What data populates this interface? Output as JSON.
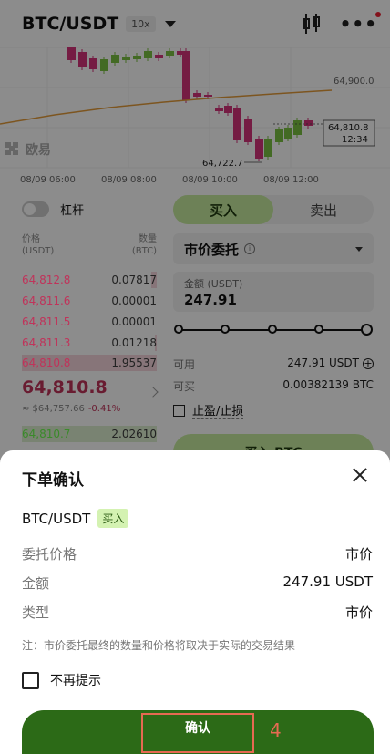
{
  "header": {
    "pair": "BTC/USDT",
    "leverage": "10x"
  },
  "chart": {
    "price_labels": [
      "64,900.0"
    ],
    "current_price_box": {
      "price": "64,810.8",
      "time": "12:34"
    },
    "low_label": "64,722.7",
    "time_labels": [
      "08/09 06:00",
      "08/09 08:00",
      "08/09 10:00",
      "08/09 12:00"
    ],
    "watermark": "欧易",
    "colors": {
      "up": "#7bc142",
      "down": "#d6347a",
      "ma": "#e39b3a"
    }
  },
  "leverage_toggle": {
    "label": "杠杆"
  },
  "orderbook": {
    "header": {
      "price": "价格",
      "price_unit": "(USDT)",
      "qty": "数量",
      "qty_unit": "(BTC)"
    },
    "asks": [
      {
        "price": "64,812.8",
        "qty": "0.07817"
      },
      {
        "price": "64,811.6",
        "qty": "0.00001"
      },
      {
        "price": "64,811.5",
        "qty": "0.00001"
      },
      {
        "price": "64,811.3",
        "qty": "0.01218"
      },
      {
        "price": "64,810.8",
        "qty": "1.95537"
      }
    ],
    "last_price": "64,810.8",
    "last_ref": "≈ $64,757.66",
    "last_change": "-0.41%",
    "bids": [
      {
        "price": "64,810.7",
        "qty": "2.02610"
      }
    ]
  },
  "trade": {
    "tab_buy": "买入",
    "tab_sell": "卖出",
    "order_type": "市价委托",
    "amount_label": "金额 (USDT)",
    "amount_value": "247.91",
    "available_label": "可用",
    "available_value": "247.91 USDT",
    "buyable_label": "可买",
    "buyable_value": "0.00382139 BTC",
    "tpsl_label": "止盈/止损",
    "buy_button": "买入 BTC"
  },
  "dialog": {
    "title": "下单确认",
    "pair": "BTC/USDT",
    "side_badge": "买入",
    "rows": [
      {
        "label": "委托价格",
        "value": "市价"
      },
      {
        "label": "金额",
        "value": "247.91 USDT"
      },
      {
        "label": "类型",
        "value": "市价"
      }
    ],
    "note": "注：市价委托最终的数量和价格将取决于实际的交易结果",
    "no_remind": "不再提示",
    "confirm": "确认"
  },
  "annotation": {
    "step": "4",
    "color": "#e66a52"
  }
}
